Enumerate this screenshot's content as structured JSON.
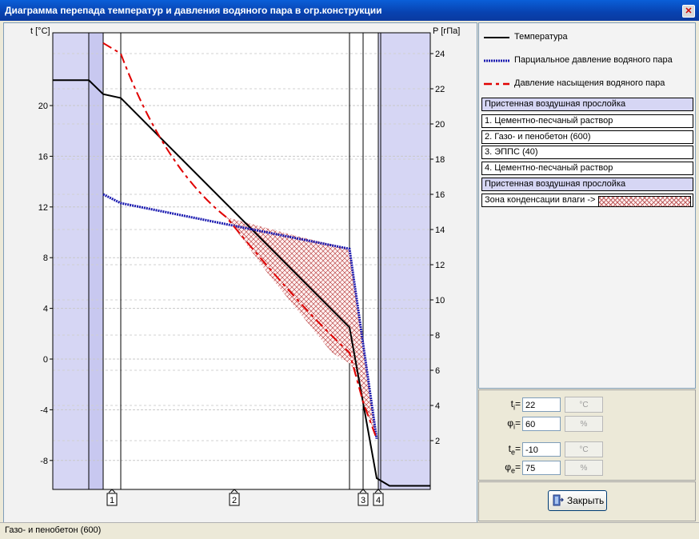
{
  "window": {
    "title": "Диаграмма перепада температур и давления водяного пара в огр.конструкции"
  },
  "chart_data": {
    "type": "line",
    "ylabel_left": "t [°C]",
    "ylabel_right": "P [гПа]",
    "ylim_left": [
      -12,
      24
    ],
    "ylim_right": [
      0,
      25.9
    ],
    "yticks_left": [
      "20",
      "16",
      "12",
      "8",
      "4",
      "0",
      "-4",
      "-8"
    ],
    "yticks_right": [
      "24",
      "22",
      "20",
      "18",
      "16",
      "14",
      "12",
      "10",
      "8",
      "6",
      "4",
      "2"
    ],
    "layer_markers": [
      "1",
      "2",
      "3",
      "4"
    ],
    "series": [
      {
        "name": "Температура",
        "values": [
          22,
          22,
          20.9,
          20.6,
          2.5,
          -9.4,
          -10,
          -10
        ]
      },
      {
        "name": "Парциальное давление водяного пара",
        "values": [
          16,
          15.5,
          12.9,
          2.1
        ]
      },
      {
        "name": "Давление насыщения водяного пара",
        "values": [
          24.6,
          24,
          18,
          7,
          4.2,
          2.1
        ]
      }
    ]
  },
  "legend": [
    {
      "label": "Температура",
      "color": "#000000"
    },
    {
      "label": "Парциальное давление водяного пара",
      "color": "#1a1ab0"
    },
    {
      "label": "Давление насыщения водяного пара",
      "color": "#e00000"
    }
  ],
  "layers": [
    {
      "label": "Пристенная воздушная прослойка",
      "air": true
    },
    {
      "label": "1. Цементно-песчаный раствор",
      "air": false
    },
    {
      "label": "2. Газо- и пенобетон (600)",
      "air": false
    },
    {
      "label": "3. ЭППС  (40)",
      "air": false
    },
    {
      "label": "4. Цементно-песчаный раствор",
      "air": false
    },
    {
      "label": "Пристенная воздушная прослойка",
      "air": true
    }
  ],
  "condensation": {
    "label": "Зона конденсации влаги ->"
  },
  "params": {
    "ti": {
      "label": "t",
      "sub": "i",
      "value": "22",
      "unit": "°C"
    },
    "phii": {
      "label": "φ",
      "sub": "i",
      "value": "60",
      "unit": "%"
    },
    "te": {
      "label": "t",
      "sub": "e",
      "value": "-10",
      "unit": "°C"
    },
    "phie": {
      "label": "φ",
      "sub": "e",
      "value": "75",
      "unit": "%"
    }
  },
  "buttons": {
    "close": "Закрыть"
  },
  "status": {
    "text": "Газо- и пенобетон (600)"
  }
}
